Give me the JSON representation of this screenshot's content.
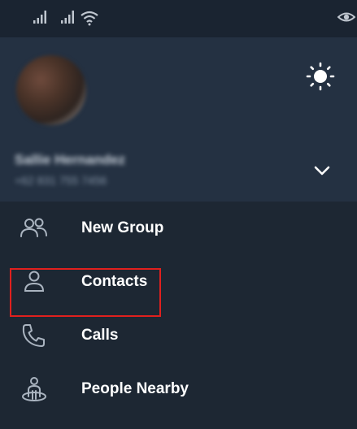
{
  "header": {
    "user_name": "Sallie Hernandez",
    "user_phone": "+62 831 755 7456"
  },
  "icons": {
    "theme": "sun-icon",
    "expand": "chevron-down-icon",
    "visibility": "eye-icon"
  },
  "menu": {
    "items": [
      {
        "label": "New Group",
        "icon": "group-icon"
      },
      {
        "label": "Contacts",
        "icon": "person-icon"
      },
      {
        "label": "Calls",
        "icon": "phone-icon"
      },
      {
        "label": "People Nearby",
        "icon": "people-nearby-icon"
      }
    ],
    "highlighted_item": "Contacts"
  },
  "colors": {
    "background": "#1d2733",
    "header": "#243142",
    "highlight": "#e0201e",
    "icon": "#aab4c0"
  }
}
